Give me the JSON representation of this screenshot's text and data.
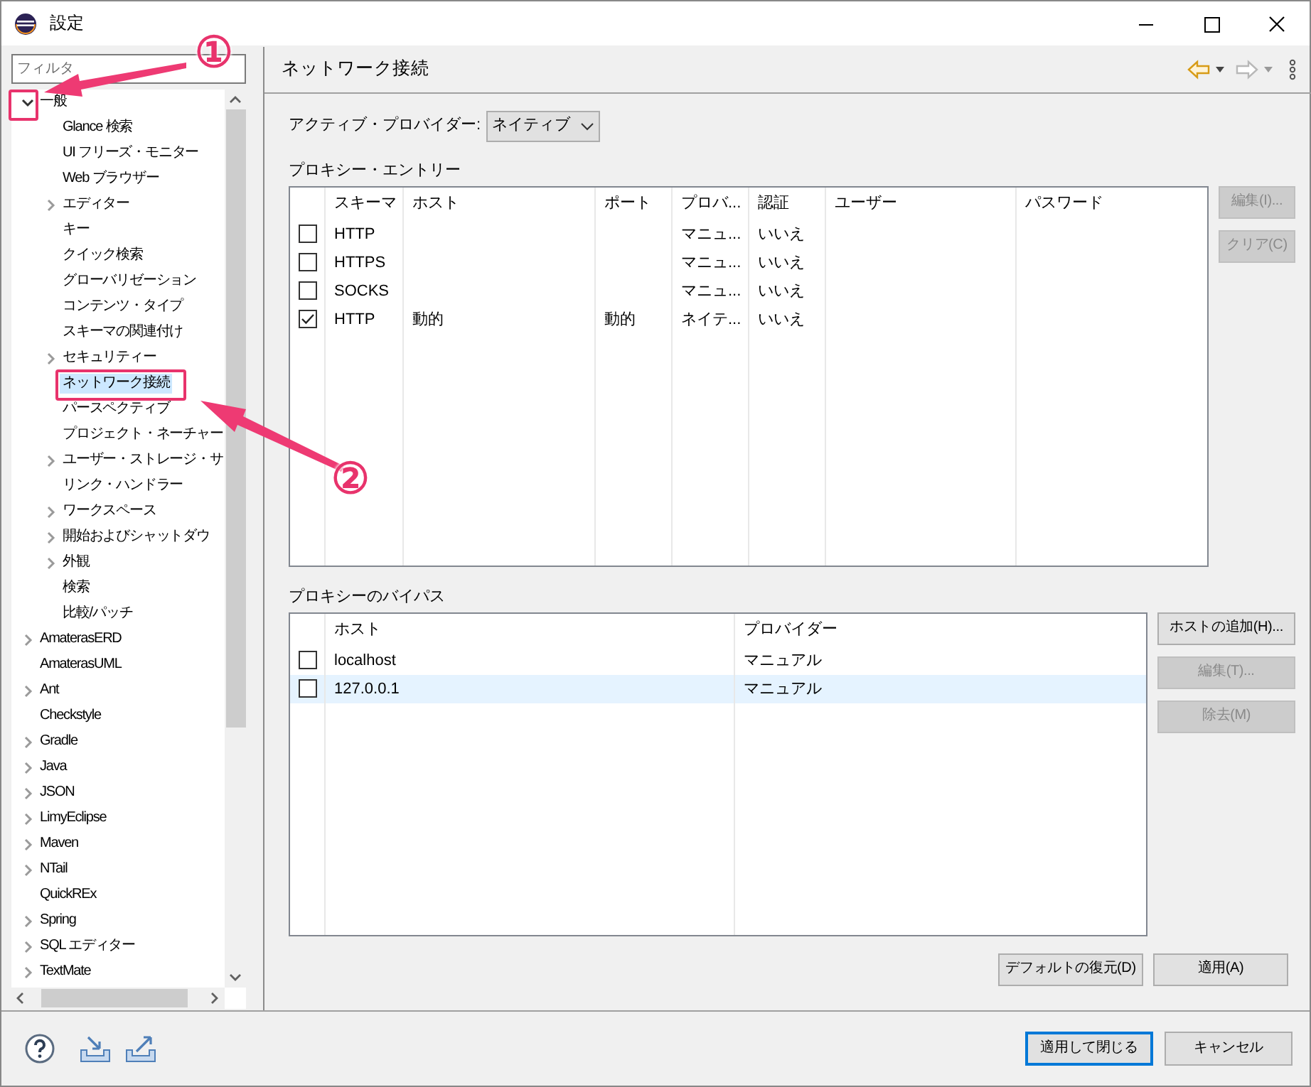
{
  "window": {
    "title": "設定"
  },
  "filter": {
    "placeholder": "フィルタ"
  },
  "tree": [
    {
      "label": "一般",
      "kind": "group",
      "expanded": true,
      "selected": false,
      "children": [
        {
          "label": "Glance 検索",
          "kind": "leaf",
          "selected": false
        },
        {
          "label": "UI フリーズ・モニター",
          "kind": "leaf",
          "selected": false
        },
        {
          "label": "Web ブラウザー",
          "kind": "leaf",
          "selected": false
        },
        {
          "label": "エディター",
          "kind": "group",
          "expanded": false,
          "selected": false
        },
        {
          "label": "キー",
          "kind": "leaf",
          "selected": false
        },
        {
          "label": "クイック検索",
          "kind": "leaf",
          "selected": false
        },
        {
          "label": "グローバリゼーション",
          "kind": "leaf",
          "selected": false
        },
        {
          "label": "コンテンツ・タイプ",
          "kind": "leaf",
          "selected": false
        },
        {
          "label": "スキーマの関連付け",
          "kind": "leaf",
          "selected": false
        },
        {
          "label": "セキュリティー",
          "kind": "group",
          "expanded": false,
          "selected": false
        },
        {
          "label": "ネットワーク接続",
          "kind": "leaf",
          "selected": true
        },
        {
          "label": "パースペクティブ",
          "kind": "leaf",
          "selected": false
        },
        {
          "label": "プロジェクト・ネーチャー",
          "kind": "leaf",
          "selected": false
        },
        {
          "label": "ユーザー・ストレージ・サ",
          "kind": "group",
          "expanded": false,
          "selected": false
        },
        {
          "label": "リンク・ハンドラー",
          "kind": "leaf",
          "selected": false
        },
        {
          "label": "ワークスペース",
          "kind": "group",
          "expanded": false,
          "selected": false
        },
        {
          "label": "開始およびシャットダウ",
          "kind": "group",
          "expanded": false,
          "selected": false
        },
        {
          "label": "外観",
          "kind": "group",
          "expanded": false,
          "selected": false
        },
        {
          "label": "検索",
          "kind": "leaf",
          "selected": false
        },
        {
          "label": "比較/パッチ",
          "kind": "leaf",
          "selected": false
        }
      ]
    },
    {
      "label": "AmaterasERD",
      "kind": "group",
      "expanded": false,
      "selected": false
    },
    {
      "label": "AmaterasUML",
      "kind": "leaf",
      "selected": false
    },
    {
      "label": "Ant",
      "kind": "group",
      "expanded": false,
      "selected": false
    },
    {
      "label": "Checkstyle",
      "kind": "leaf",
      "selected": false
    },
    {
      "label": "Gradle",
      "kind": "group",
      "expanded": false,
      "selected": false
    },
    {
      "label": "Java",
      "kind": "group",
      "expanded": false,
      "selected": false
    },
    {
      "label": "JSON",
      "kind": "group",
      "expanded": false,
      "selected": false
    },
    {
      "label": "LimyEclipse",
      "kind": "group",
      "expanded": false,
      "selected": false
    },
    {
      "label": "Maven",
      "kind": "group",
      "expanded": false,
      "selected": false
    },
    {
      "label": "NTail",
      "kind": "group",
      "expanded": false,
      "selected": false
    },
    {
      "label": "QuickREx",
      "kind": "leaf",
      "selected": false
    },
    {
      "label": "Spring",
      "kind": "group",
      "expanded": false,
      "selected": false
    },
    {
      "label": "SQL エディター",
      "kind": "group",
      "expanded": false,
      "selected": false
    },
    {
      "label": "TextMate",
      "kind": "group",
      "expanded": false,
      "selected": false
    }
  ],
  "page": {
    "title": "ネットワーク接続",
    "provider": {
      "label": "アクティブ・プロバイダー:",
      "value": "ネイティブ"
    },
    "proxy_entries": {
      "label": "プロキシー・エントリー",
      "columns": [
        "スキーマ",
        "ホスト",
        "ポート",
        "プロバ...",
        "認証",
        "ユーザー",
        "パスワード"
      ],
      "rows": [
        {
          "checked": false,
          "selected": false,
          "cells": [
            "HTTP",
            null,
            null,
            "マニュ...",
            "いいえ",
            null,
            null
          ]
        },
        {
          "checked": false,
          "selected": false,
          "cells": [
            "HTTPS",
            null,
            null,
            "マニュ...",
            "いいえ",
            null,
            null
          ]
        },
        {
          "checked": false,
          "selected": false,
          "cells": [
            "SOCKS",
            null,
            null,
            "マニュ...",
            "いいえ",
            null,
            null
          ]
        },
        {
          "checked": true,
          "selected": false,
          "cells": [
            "HTTP",
            "動的",
            "動的",
            "ネイテ...",
            "いいえ",
            null,
            null
          ]
        }
      ],
      "buttons": [
        {
          "label": "編集(I)...",
          "disabled": true
        },
        {
          "label": "クリア(C)",
          "disabled": true
        }
      ]
    },
    "proxy_bypass": {
      "label": "プロキシーのバイパス",
      "columns": [
        "ホスト",
        "プロバイダー"
      ],
      "rows": [
        {
          "checked": false,
          "selected": false,
          "cells": [
            "localhost",
            "マニュアル"
          ]
        },
        {
          "checked": false,
          "selected": true,
          "cells": [
            "127.0.0.1",
            "マニュアル"
          ]
        }
      ],
      "buttons": [
        {
          "label": "ホストの追加(H)...",
          "disabled": false
        },
        {
          "label": "編集(T)...",
          "disabled": true
        },
        {
          "label": "除去(M)",
          "disabled": true
        }
      ]
    },
    "buttons": [
      {
        "label": "デフォルトの復元(D)",
        "disabled": false
      },
      {
        "label": "適用(A)",
        "disabled": false
      }
    ]
  },
  "footer_buttons": [
    {
      "label": "適用して閉じる",
      "default": true
    },
    {
      "label": "キャンセル",
      "default": false
    }
  ],
  "annotations": [
    {
      "label": "①"
    },
    {
      "label": "②"
    }
  ]
}
